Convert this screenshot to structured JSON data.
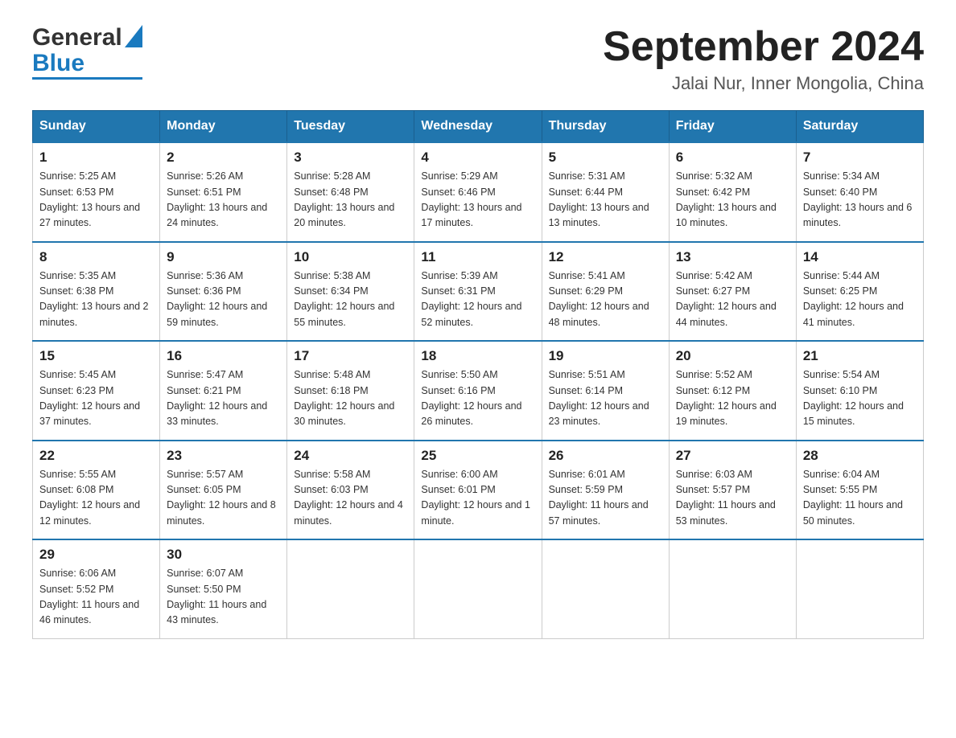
{
  "header": {
    "logo_general": "General",
    "logo_blue": "Blue",
    "title": "September 2024",
    "location": "Jalai Nur, Inner Mongolia, China"
  },
  "weekdays": [
    "Sunday",
    "Monday",
    "Tuesday",
    "Wednesday",
    "Thursday",
    "Friday",
    "Saturday"
  ],
  "weeks": [
    [
      {
        "day": "1",
        "sunrise": "5:25 AM",
        "sunset": "6:53 PM",
        "daylight": "13 hours and 27 minutes."
      },
      {
        "day": "2",
        "sunrise": "5:26 AM",
        "sunset": "6:51 PM",
        "daylight": "13 hours and 24 minutes."
      },
      {
        "day": "3",
        "sunrise": "5:28 AM",
        "sunset": "6:48 PM",
        "daylight": "13 hours and 20 minutes."
      },
      {
        "day": "4",
        "sunrise": "5:29 AM",
        "sunset": "6:46 PM",
        "daylight": "13 hours and 17 minutes."
      },
      {
        "day": "5",
        "sunrise": "5:31 AM",
        "sunset": "6:44 PM",
        "daylight": "13 hours and 13 minutes."
      },
      {
        "day": "6",
        "sunrise": "5:32 AM",
        "sunset": "6:42 PM",
        "daylight": "13 hours and 10 minutes."
      },
      {
        "day": "7",
        "sunrise": "5:34 AM",
        "sunset": "6:40 PM",
        "daylight": "13 hours and 6 minutes."
      }
    ],
    [
      {
        "day": "8",
        "sunrise": "5:35 AM",
        "sunset": "6:38 PM",
        "daylight": "13 hours and 2 minutes."
      },
      {
        "day": "9",
        "sunrise": "5:36 AM",
        "sunset": "6:36 PM",
        "daylight": "12 hours and 59 minutes."
      },
      {
        "day": "10",
        "sunrise": "5:38 AM",
        "sunset": "6:34 PM",
        "daylight": "12 hours and 55 minutes."
      },
      {
        "day": "11",
        "sunrise": "5:39 AM",
        "sunset": "6:31 PM",
        "daylight": "12 hours and 52 minutes."
      },
      {
        "day": "12",
        "sunrise": "5:41 AM",
        "sunset": "6:29 PM",
        "daylight": "12 hours and 48 minutes."
      },
      {
        "day": "13",
        "sunrise": "5:42 AM",
        "sunset": "6:27 PM",
        "daylight": "12 hours and 44 minutes."
      },
      {
        "day": "14",
        "sunrise": "5:44 AM",
        "sunset": "6:25 PM",
        "daylight": "12 hours and 41 minutes."
      }
    ],
    [
      {
        "day": "15",
        "sunrise": "5:45 AM",
        "sunset": "6:23 PM",
        "daylight": "12 hours and 37 minutes."
      },
      {
        "day": "16",
        "sunrise": "5:47 AM",
        "sunset": "6:21 PM",
        "daylight": "12 hours and 33 minutes."
      },
      {
        "day": "17",
        "sunrise": "5:48 AM",
        "sunset": "6:18 PM",
        "daylight": "12 hours and 30 minutes."
      },
      {
        "day": "18",
        "sunrise": "5:50 AM",
        "sunset": "6:16 PM",
        "daylight": "12 hours and 26 minutes."
      },
      {
        "day": "19",
        "sunrise": "5:51 AM",
        "sunset": "6:14 PM",
        "daylight": "12 hours and 23 minutes."
      },
      {
        "day": "20",
        "sunrise": "5:52 AM",
        "sunset": "6:12 PM",
        "daylight": "12 hours and 19 minutes."
      },
      {
        "day": "21",
        "sunrise": "5:54 AM",
        "sunset": "6:10 PM",
        "daylight": "12 hours and 15 minutes."
      }
    ],
    [
      {
        "day": "22",
        "sunrise": "5:55 AM",
        "sunset": "6:08 PM",
        "daylight": "12 hours and 12 minutes."
      },
      {
        "day": "23",
        "sunrise": "5:57 AM",
        "sunset": "6:05 PM",
        "daylight": "12 hours and 8 minutes."
      },
      {
        "day": "24",
        "sunrise": "5:58 AM",
        "sunset": "6:03 PM",
        "daylight": "12 hours and 4 minutes."
      },
      {
        "day": "25",
        "sunrise": "6:00 AM",
        "sunset": "6:01 PM",
        "daylight": "12 hours and 1 minute."
      },
      {
        "day": "26",
        "sunrise": "6:01 AM",
        "sunset": "5:59 PM",
        "daylight": "11 hours and 57 minutes."
      },
      {
        "day": "27",
        "sunrise": "6:03 AM",
        "sunset": "5:57 PM",
        "daylight": "11 hours and 53 minutes."
      },
      {
        "day": "28",
        "sunrise": "6:04 AM",
        "sunset": "5:55 PM",
        "daylight": "11 hours and 50 minutes."
      }
    ],
    [
      {
        "day": "29",
        "sunrise": "6:06 AM",
        "sunset": "5:52 PM",
        "daylight": "11 hours and 46 minutes."
      },
      {
        "day": "30",
        "sunrise": "6:07 AM",
        "sunset": "5:50 PM",
        "daylight": "11 hours and 43 minutes."
      },
      null,
      null,
      null,
      null,
      null
    ]
  ]
}
